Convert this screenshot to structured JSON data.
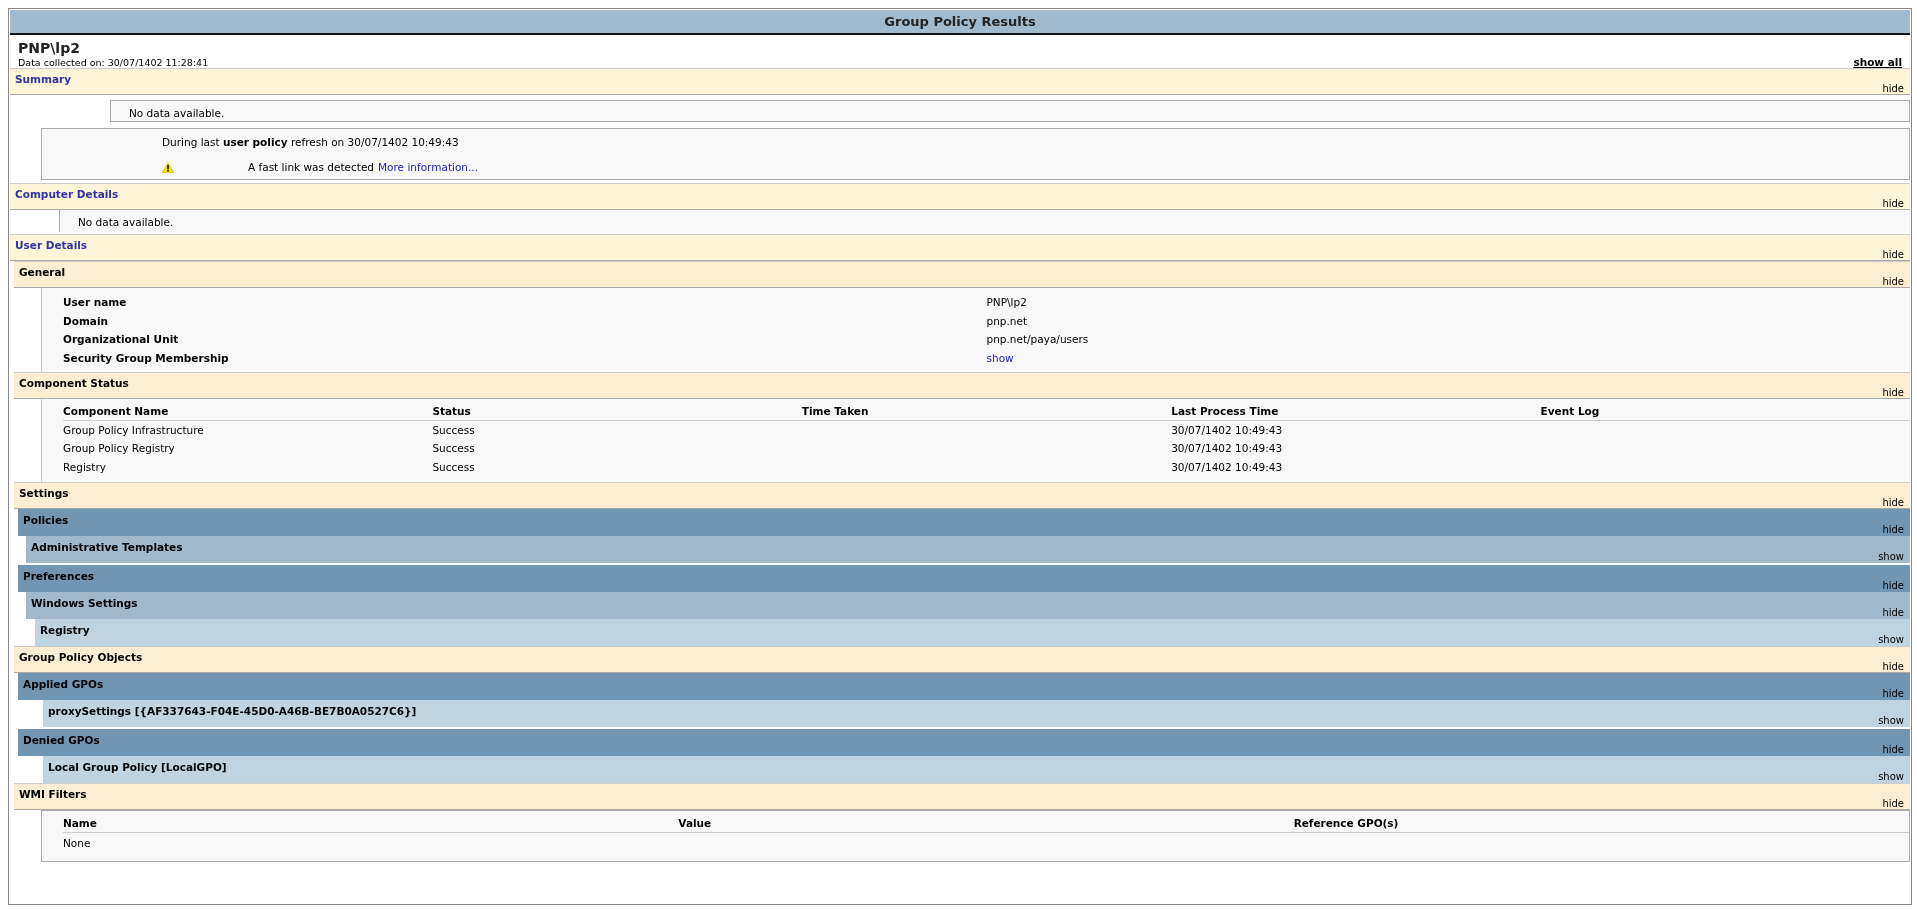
{
  "report": {
    "title": "Group Policy Results",
    "user": "PNP\\lp2",
    "collected": "Data collected on: 30/07/1402 11:28:41",
    "show_all": "show all"
  },
  "sections": [
    {
      "kind": "section",
      "title": "Summary",
      "toggle": "hide",
      "content": [
        {
          "kind": "inset-message",
          "text": "No data available."
        },
        {
          "kind": "refresh",
          "text": "During last **user policy** refresh on 30/07/1402 10:49:43",
          "warning": "A fast link was detected",
          "link": "More information..."
        }
      ]
    },
    {
      "kind": "section",
      "title": "Computer Details",
      "toggle": "hide",
      "content": [
        {
          "kind": "message",
          "text": "No data available."
        }
      ]
    },
    {
      "kind": "section",
      "title": "User Details",
      "toggle": "hide",
      "children": [
        {
          "kind": "subsection",
          "title": "General",
          "toggle": "hide",
          "content": [
            {
              "kind": "properties",
              "rows": [
                {
                  "label": "User name",
                  "value": "PNP\\lp2",
                  "kind": "text"
                },
                {
                  "label": "Domain",
                  "value": "pnp.net",
                  "kind": "text"
                },
                {
                  "label": "Organizational Unit",
                  "value": "pnp.net/paya/users",
                  "kind": "text"
                },
                {
                  "label": "Security Group Membership",
                  "value": "show",
                  "kind": "link"
                }
              ]
            }
          ]
        },
        {
          "kind": "subsection",
          "title": "Component Status",
          "toggle": "hide",
          "content": [
            {
              "kind": "table",
              "columns": [
                "Component Name",
                "Status",
                "Time Taken",
                "Last Process Time",
                "Event Log"
              ],
              "rows": [
                [
                  "Group Policy Infrastructure",
                  "Success",
                  "",
                  "30/07/1402 10:49:43",
                  ""
                ],
                [
                  "Group Policy Registry",
                  "Success",
                  "",
                  "30/07/1402 10:49:43",
                  ""
                ],
                [
                  "Registry",
                  "Success",
                  "",
                  "30/07/1402 10:49:43",
                  ""
                ]
              ]
            }
          ]
        },
        {
          "kind": "subsection",
          "title": "Settings",
          "toggle": "hide",
          "children": [
            {
              "kind": "category",
              "title": "Policies",
              "toggle": "hide",
              "children": [
                {
                  "kind": "extension",
                  "title": "Administrative Templates",
                  "toggle": "show"
                }
              ]
            },
            {
              "kind": "category",
              "title": "Preferences",
              "toggle": "hide",
              "children": [
                {
                  "kind": "extension",
                  "title": "Windows Settings",
                  "toggle": "hide",
                  "children": [
                    {
                      "kind": "setting",
                      "title": "Registry",
                      "toggle": "show"
                    }
                  ]
                }
              ]
            }
          ]
        },
        {
          "kind": "subsection",
          "title": "Group Policy Objects",
          "toggle": "hide",
          "children": [
            {
              "kind": "category",
              "title": "Applied GPOs",
              "toggle": "hide",
              "children": [
                {
                  "kind": "gpo",
                  "title": "proxySettings [{AF337643-F04E-45D0-A46B-BE7B0A0527C6}]",
                  "toggle": "show"
                }
              ]
            },
            {
              "kind": "category",
              "title": "Denied GPOs",
              "toggle": "hide",
              "children": [
                {
                  "kind": "gpo",
                  "title": "Local Group Policy [LocalGPO]",
                  "toggle": "show"
                }
              ]
            }
          ]
        },
        {
          "kind": "subsection",
          "title": "WMI Filters",
          "toggle": "hide",
          "content": [
            {
              "kind": "boxed-table",
              "columns": [
                "Name",
                "Value",
                "Reference GPO(s)"
              ],
              "rows": [
                [
                  "None",
                  "",
                  ""
                ]
              ]
            }
          ]
        }
      ]
    }
  ]
}
